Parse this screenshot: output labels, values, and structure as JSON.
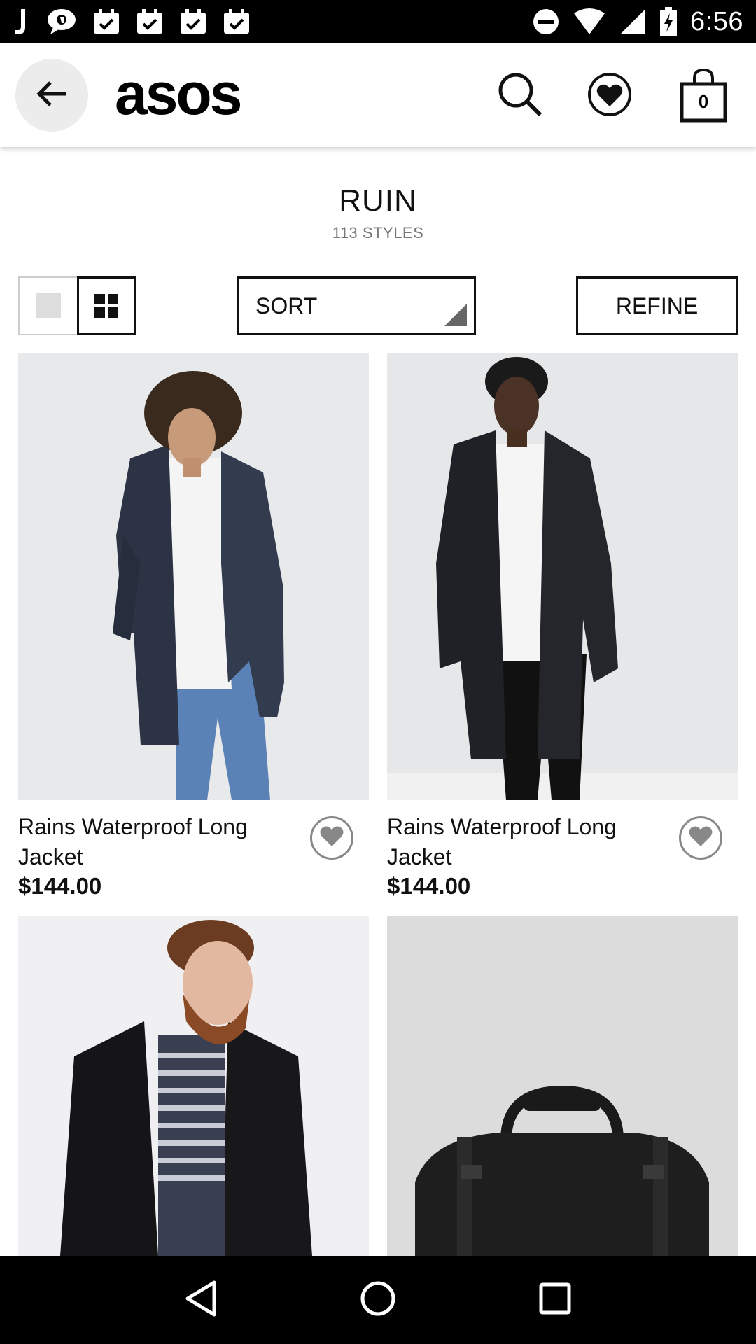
{
  "status_bar": {
    "time": "6:56",
    "left_icons": [
      "j-app-icon",
      "messenger-icon",
      "calendar-check-icon",
      "calendar-check-icon",
      "calendar-check-icon",
      "calendar-check-icon"
    ],
    "right_icons": [
      "do-not-disturb-icon",
      "wifi-icon",
      "signal-icon",
      "battery-charging-icon"
    ]
  },
  "header": {
    "logo": "asos",
    "bag_count": "0",
    "icons": [
      "back-arrow-icon",
      "search-icon",
      "heart-icon",
      "shopping-bag-icon"
    ]
  },
  "listing": {
    "title": "RUIN",
    "styles_count": "113 STYLES",
    "sort_label": "SORT",
    "refine_label": "REFINE",
    "view_mode": "grid"
  },
  "products": [
    {
      "name": "Rains Waterproof Long Jacket",
      "price": "$144.00"
    },
    {
      "name": "Rains Waterproof Long Jacket",
      "price": "$144.00"
    },
    {
      "name": "",
      "price": ""
    },
    {
      "name": "",
      "price": ""
    }
  ],
  "nav": {
    "icons": [
      "back-triangle-icon",
      "home-circle-icon",
      "recents-square-icon"
    ]
  },
  "colors": {
    "accent": "#000000",
    "background": "#ffffff",
    "image_bg": "#e9eaec"
  }
}
